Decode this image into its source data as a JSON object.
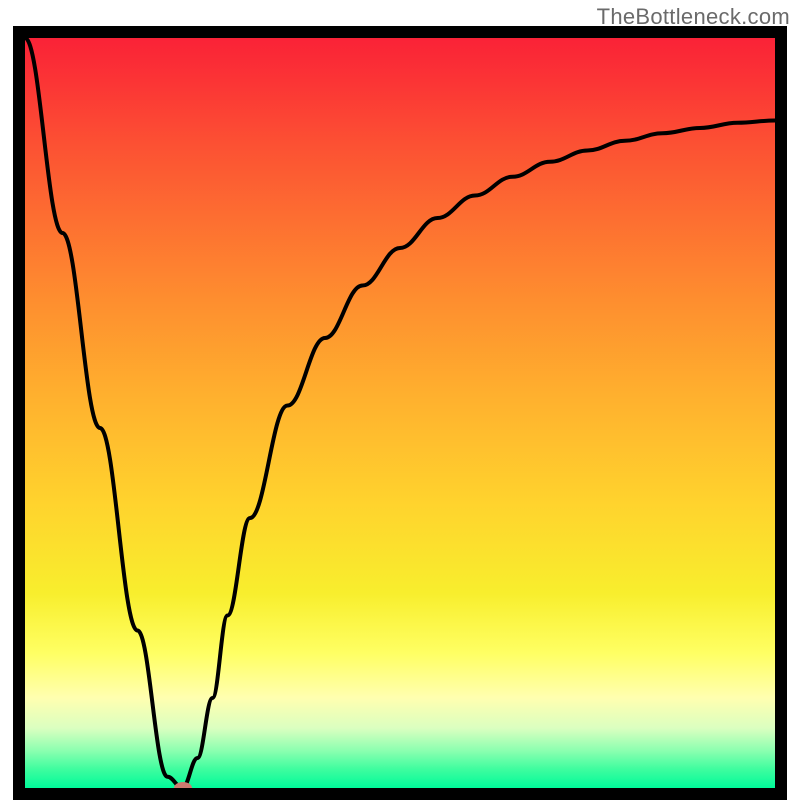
{
  "watermark": {
    "text": "TheBottleneck.com"
  },
  "chart_data": {
    "type": "line",
    "title": "",
    "xlabel": "",
    "ylabel": "",
    "xlim": [
      0,
      100
    ],
    "ylim": [
      0,
      100
    ],
    "grid": false,
    "legend": false,
    "annotations": [
      {
        "text": "TheBottleneck.com",
        "position": "top-right"
      }
    ],
    "background_gradient": {
      "orientation": "vertical",
      "top_color": "#fa2237",
      "bottom_color": "#00fa9a",
      "note": "red (top, high y / bad) to green (bottom, low y / good)"
    },
    "series": [
      {
        "name": "bottleneck-curve",
        "color": "#000000",
        "x": [
          0,
          5,
          10,
          15,
          19,
          21,
          23,
          25,
          27,
          30,
          35,
          40,
          45,
          50,
          55,
          60,
          65,
          70,
          75,
          80,
          85,
          90,
          95,
          100
        ],
        "y": [
          100,
          74,
          48,
          21,
          1.5,
          0,
          4,
          12,
          23,
          36,
          51,
          60,
          67,
          72,
          76,
          79,
          81.5,
          83.5,
          85,
          86.3,
          87.3,
          88,
          88.7,
          89
        ]
      }
    ],
    "marker": {
      "name": "optimal-point",
      "x": 21,
      "y": 0,
      "color": "#cd7a70"
    }
  }
}
